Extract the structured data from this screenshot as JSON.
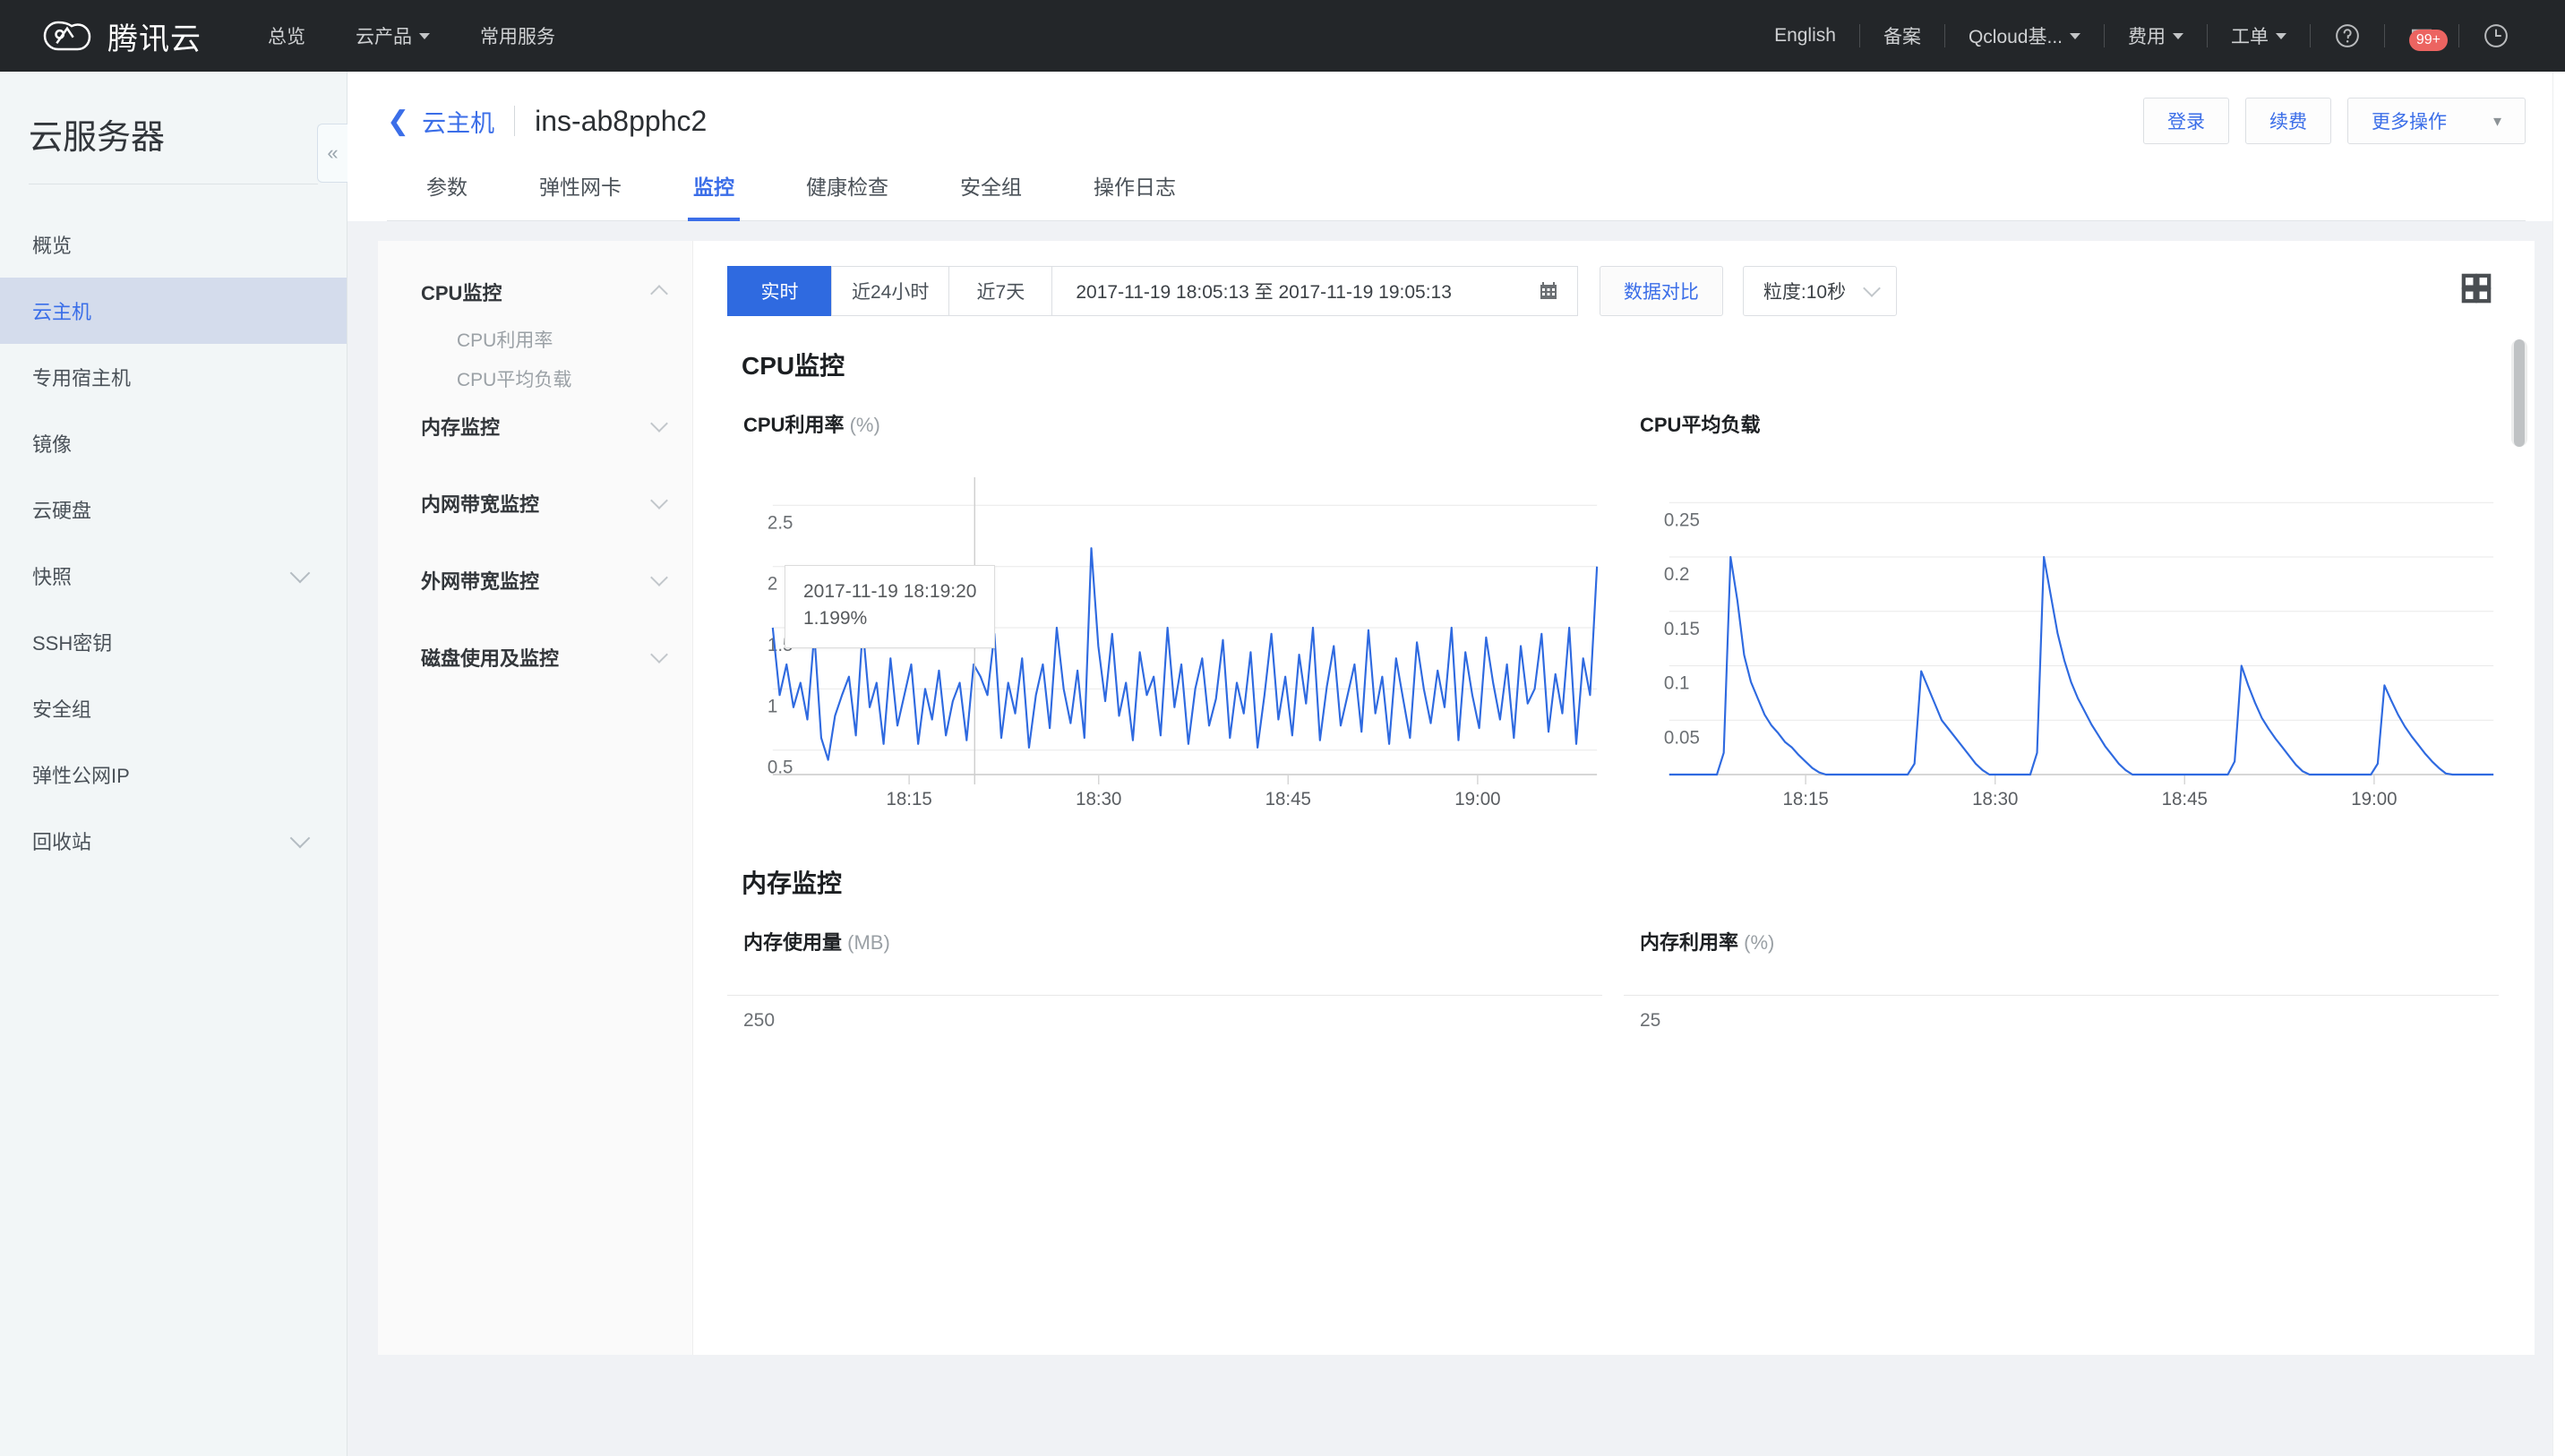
{
  "topnav": {
    "brand": "腾讯云",
    "left_items": [
      {
        "label": "总览",
        "caret": false
      },
      {
        "label": "云产品",
        "caret": true
      },
      {
        "label": "常用服务",
        "caret": false
      }
    ],
    "right_items": [
      {
        "label": "English",
        "caret": false
      },
      {
        "label": "备案",
        "caret": false
      },
      {
        "label": "Qcloud基...",
        "caret": true
      },
      {
        "label": "费用",
        "caret": true
      },
      {
        "label": "工单",
        "caret": true
      }
    ],
    "help_icon": "question-circle-icon",
    "notification_icon": "notification-icon",
    "notification_badge": "99+",
    "history_icon": "clock-icon"
  },
  "sidebar": {
    "title": "云服务器",
    "collapse_label": "«",
    "items": [
      {
        "label": "概览",
        "active": false,
        "expandable": false
      },
      {
        "label": "云主机",
        "active": true,
        "expandable": false
      },
      {
        "label": "专用宿主机",
        "active": false,
        "expandable": false
      },
      {
        "label": "镜像",
        "active": false,
        "expandable": false
      },
      {
        "label": "云硬盘",
        "active": false,
        "expandable": false
      },
      {
        "label": "快照",
        "active": false,
        "expandable": true
      },
      {
        "label": "SSH密钥",
        "active": false,
        "expandable": false
      },
      {
        "label": "安全组",
        "active": false,
        "expandable": false
      },
      {
        "label": "弹性公网IP",
        "active": false,
        "expandable": false
      },
      {
        "label": "回收站",
        "active": false,
        "expandable": true
      }
    ]
  },
  "page": {
    "back_icon": "chevron-left-icon",
    "breadcrumb_link": "云主机",
    "instance_id": "ins-ab8pphc2",
    "actions": [
      {
        "label": "登录",
        "caret": false
      },
      {
        "label": "续费",
        "caret": false
      },
      {
        "label": "更多操作",
        "caret": true
      }
    ],
    "tabs": [
      {
        "label": "参数",
        "active": false
      },
      {
        "label": "弹性网卡",
        "active": false
      },
      {
        "label": "监控",
        "active": true
      },
      {
        "label": "健康检查",
        "active": false
      },
      {
        "label": "安全组",
        "active": false
      },
      {
        "label": "操作日志",
        "active": false
      }
    ]
  },
  "inner_nav": [
    {
      "label": "CPU监控",
      "expanded": true,
      "children": [
        "CPU利用率",
        "CPU平均负载"
      ]
    },
    {
      "label": "内存监控",
      "expanded": false,
      "children": []
    },
    {
      "label": "内网带宽监控",
      "expanded": false,
      "children": []
    },
    {
      "label": "外网带宽监控",
      "expanded": false,
      "children": []
    },
    {
      "label": "磁盘使用及监控",
      "expanded": false,
      "children": []
    }
  ],
  "toolbar": {
    "ranges": [
      {
        "label": "实时",
        "active": true
      },
      {
        "label": "近24小时",
        "active": false
      },
      {
        "label": "近7天",
        "active": false
      }
    ],
    "date_range": "2017-11-19 18:05:13 至 2017-11-19 19:05:13",
    "calendar_icon": "calendar-icon",
    "compare_label": "数据对比",
    "granularity_label": "粒度:10秒",
    "layout_icon": "grid-layout-icon"
  },
  "tooltip": {
    "time": "2017-11-19 18:19:20",
    "value": "1.199%"
  },
  "sections": {
    "cpu_title": "CPU监控",
    "mem_title": "内存监控"
  },
  "colors": {
    "accent": "#2f6ae0",
    "line": "#2f6ae0",
    "nav_bg": "#232629",
    "sidebar_bg": "#f2f6f7",
    "badge": "#ec6461"
  },
  "chart_data": [
    {
      "type": "line",
      "title": "CPU利用率",
      "unit": "(%)",
      "xlabel": "",
      "ylabel": "",
      "ylim": [
        0.3,
        2.7
      ],
      "yticks": [
        "2.5",
        "2",
        "1.5",
        "1",
        "0.5"
      ],
      "ytick_values": [
        2.5,
        2.0,
        1.5,
        1.0,
        0.5
      ],
      "xticks": [
        "18:15",
        "18:30",
        "18:45",
        "19:00"
      ],
      "grid": true,
      "legend": "none",
      "annotation": {
        "time": "2017-11-19 18:19:20",
        "value": "1.199%"
      },
      "series": [
        {
          "name": "CPU利用率",
          "values": [
            1.5,
            0.95,
            1.2,
            0.85,
            1.05,
            0.75,
            1.45,
            0.6,
            0.42,
            0.78,
            0.95,
            1.1,
            0.62,
            1.5,
            0.85,
            1.05,
            0.55,
            1.25,
            0.7,
            0.95,
            1.2,
            0.55,
            1.0,
            0.75,
            1.15,
            0.62,
            0.9,
            1.05,
            0.58,
            1.2,
            1.1,
            0.95,
            1.45,
            0.6,
            1.05,
            0.8,
            1.25,
            0.52,
            0.95,
            1.2,
            0.68,
            1.5,
            1.0,
            0.72,
            1.15,
            0.6,
            2.15,
            1.35,
            0.9,
            1.45,
            0.78,
            1.05,
            0.58,
            1.3,
            0.95,
            1.1,
            0.62,
            1.5,
            0.85,
            1.2,
            0.55,
            1.0,
            1.25,
            0.7,
            0.92,
            1.4,
            0.6,
            1.05,
            0.8,
            1.3,
            0.52,
            0.95,
            1.45,
            0.75,
            1.1,
            0.62,
            1.28,
            0.88,
            1.5,
            0.58,
            1.02,
            1.35,
            0.7,
            0.95,
            1.2,
            0.65,
            1.48,
            0.8,
            1.1,
            0.55,
            1.25,
            0.92,
            0.6,
            1.38,
            1.0,
            0.72,
            1.15,
            0.85,
            1.5,
            0.58,
            1.3,
            0.95,
            0.68,
            1.42,
            1.05,
            0.75,
            1.2,
            0.6,
            1.35,
            0.88,
            1.0,
            1.45,
            0.65,
            1.12,
            0.8,
            1.5,
            0.55,
            1.25,
            0.95,
            2.0
          ]
        }
      ]
    },
    {
      "type": "line",
      "title": "CPU平均负载",
      "unit": "",
      "xlabel": "",
      "ylabel": "",
      "ylim": [
        0,
        0.27
      ],
      "yticks": [
        "0.25",
        "0.2",
        "0.15",
        "0.1",
        "0.05"
      ],
      "ytick_values": [
        0.25,
        0.2,
        0.15,
        0.1,
        0.05
      ],
      "xticks": [
        "18:15",
        "18:30",
        "18:45",
        "19:00"
      ],
      "grid": true,
      "legend": "none",
      "series": [
        {
          "name": "CPU平均负载",
          "values": [
            0,
            0,
            0,
            0,
            0,
            0,
            0,
            0,
            0.02,
            0.2,
            0.16,
            0.11,
            0.085,
            0.07,
            0.055,
            0.045,
            0.038,
            0.03,
            0.025,
            0.018,
            0.012,
            0.006,
            0.002,
            0,
            0,
            0,
            0,
            0,
            0,
            0,
            0,
            0,
            0,
            0,
            0,
            0,
            0.01,
            0.095,
            0.08,
            0.065,
            0.05,
            0.042,
            0.034,
            0.026,
            0.018,
            0.01,
            0.004,
            0,
            0,
            0,
            0,
            0,
            0,
            0,
            0.02,
            0.2,
            0.165,
            0.13,
            0.105,
            0.085,
            0.07,
            0.058,
            0.046,
            0.036,
            0.026,
            0.018,
            0.01,
            0.004,
            0,
            0,
            0,
            0,
            0,
            0,
            0,
            0,
            0,
            0,
            0,
            0,
            0,
            0,
            0,
            0.012,
            0.1,
            0.082,
            0.066,
            0.052,
            0.042,
            0.033,
            0.025,
            0.017,
            0.009,
            0.003,
            0,
            0,
            0,
            0,
            0,
            0,
            0,
            0,
            0,
            0,
            0.01,
            0.082,
            0.068,
            0.055,
            0.044,
            0.035,
            0.027,
            0.019,
            0.012,
            0.006,
            0.001,
            0,
            0,
            0,
            0,
            0,
            0,
            0
          ]
        }
      ]
    },
    {
      "type": "line",
      "title": "内存使用量",
      "unit": "(MB)",
      "yticks": [
        "250"
      ],
      "ytick_values": [
        250
      ],
      "series": [
        {
          "name": "内存使用量",
          "values": []
        }
      ]
    },
    {
      "type": "line",
      "title": "内存利用率",
      "unit": "(%)",
      "yticks": [
        "25"
      ],
      "ytick_values": [
        25
      ],
      "series": [
        {
          "name": "内存利用率",
          "values": []
        }
      ]
    }
  ]
}
